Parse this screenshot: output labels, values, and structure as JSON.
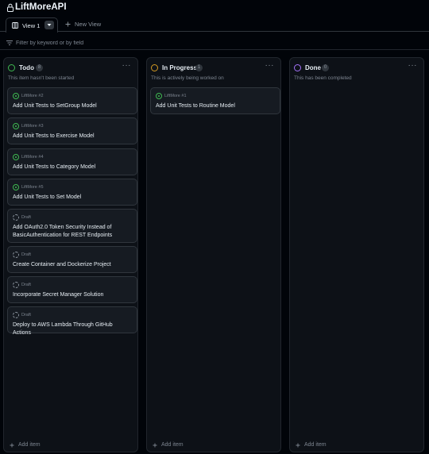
{
  "project": {
    "title": "LiftMoreAPI"
  },
  "tabs": {
    "active_label": "View 1",
    "new_view_label": "New View"
  },
  "filter": {
    "placeholder": "Filter by keyword or by field"
  },
  "colors": {
    "todo": "#3fb950",
    "in_progress": "#d29922",
    "done": "#a371f7",
    "issue_open": "#3fb950"
  },
  "columns": [
    {
      "title": "Todo",
      "count": "8",
      "menu": "···",
      "description": "This item hasn't been started",
      "add_label": "Add item",
      "cards": [
        {
          "meta": "LiftMore #2",
          "title": "Add Unit Tests to SetGroup Model",
          "icon": "issue-open-icon"
        },
        {
          "meta": "LiftMore #3",
          "title": "Add Unit Tests to Exercise Model",
          "icon": "issue-open-icon"
        },
        {
          "meta": "LiftMore #4",
          "title": "Add Unit Tests to Category Model",
          "icon": "issue-open-icon"
        },
        {
          "meta": "LiftMore #5",
          "title": "Add Unit Tests to Set Model",
          "icon": "issue-open-icon"
        },
        {
          "meta": "Draft",
          "title": "Add OAuth2.0 Token Security Instead of BasicAuthentication for REST Endpoints",
          "icon": "draft-icon"
        },
        {
          "meta": "Draft",
          "title": "Create Container and Dockerize Project",
          "icon": "draft-icon"
        },
        {
          "meta": "Draft",
          "title": "Incorporate Secret Manager Solution",
          "icon": "draft-icon"
        },
        {
          "meta": "Draft",
          "title": "Deploy to AWS Lambda Through GitHub Actions",
          "icon": "draft-icon"
        }
      ]
    },
    {
      "title": "In Progress",
      "count": "1",
      "menu": "···",
      "description": "This is actively being worked on",
      "add_label": "Add item",
      "cards": [
        {
          "meta": "LiftMore #1",
          "title": "Add Unit Tests to Routine Model",
          "icon": "issue-open-icon"
        }
      ]
    },
    {
      "title": "Done",
      "count": "0",
      "menu": "···",
      "description": "This has been completed",
      "add_label": "Add item",
      "cards": []
    }
  ]
}
